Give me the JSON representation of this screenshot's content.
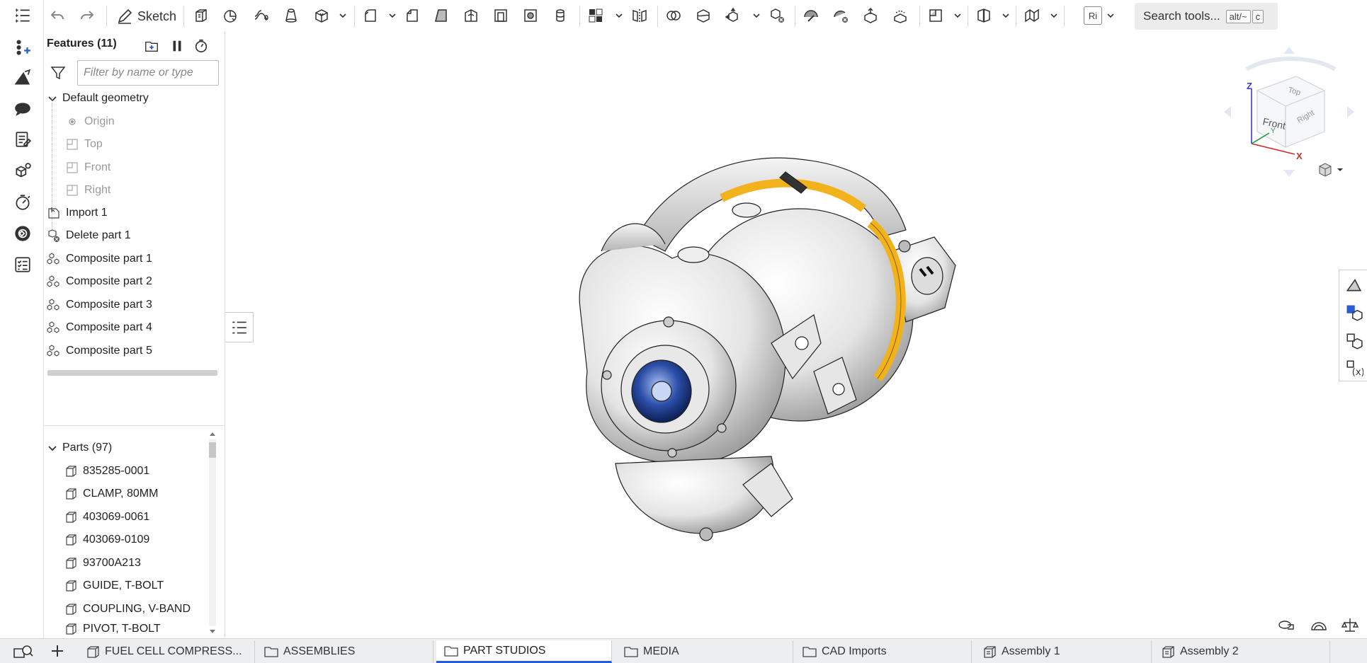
{
  "toolbar": {
    "sketch_label": "Sketch",
    "ri_label": "Ri",
    "search": {
      "label": "Search tools...",
      "key1": "alt/~",
      "key2": "c"
    }
  },
  "features": {
    "header": "Features (11)",
    "filter_placeholder": "Filter by name or type",
    "default_geometry": "Default geometry",
    "default_items": [
      "Origin",
      "Top",
      "Front",
      "Right"
    ],
    "items": [
      "Import 1",
      "Delete part 1",
      "Composite part 1",
      "Composite part 2",
      "Composite part 3",
      "Composite part 4",
      "Composite part 5"
    ]
  },
  "parts": {
    "header": "Parts (97)",
    "items": [
      "835285-0001",
      "CLAMP, 80MM",
      "403069-0061",
      "403069-0109",
      "93700A213",
      "GUIDE, T-BOLT",
      "COUPLING, V-BAND",
      "PIVOT, T-BOLT"
    ]
  },
  "viewcube": {
    "top": "Top",
    "front": "Front",
    "right": "Right",
    "z": "Z",
    "x": "X",
    "y": "Y"
  },
  "tabs": [
    {
      "label": "FUEL CELL COMPRESS...",
      "icon": "document-icon"
    },
    {
      "label": "ASSEMBLIES",
      "icon": "folder-icon"
    },
    {
      "label": "PART STUDIOS",
      "icon": "folder-icon",
      "active": true
    },
    {
      "label": "MEDIA",
      "icon": "folder-icon"
    },
    {
      "label": "CAD Imports",
      "icon": "folder-icon"
    },
    {
      "label": "Assembly 1",
      "icon": "assembly-icon"
    },
    {
      "label": "Assembly 2",
      "icon": "assembly-icon"
    }
  ],
  "colors": {
    "accent": "#2a5bd7",
    "highlight_yellow": "#f2b21b",
    "impeller_blue": "#2b4ea8",
    "axis_blue": "#3a3ad0",
    "axis_red": "#d02a2a"
  }
}
